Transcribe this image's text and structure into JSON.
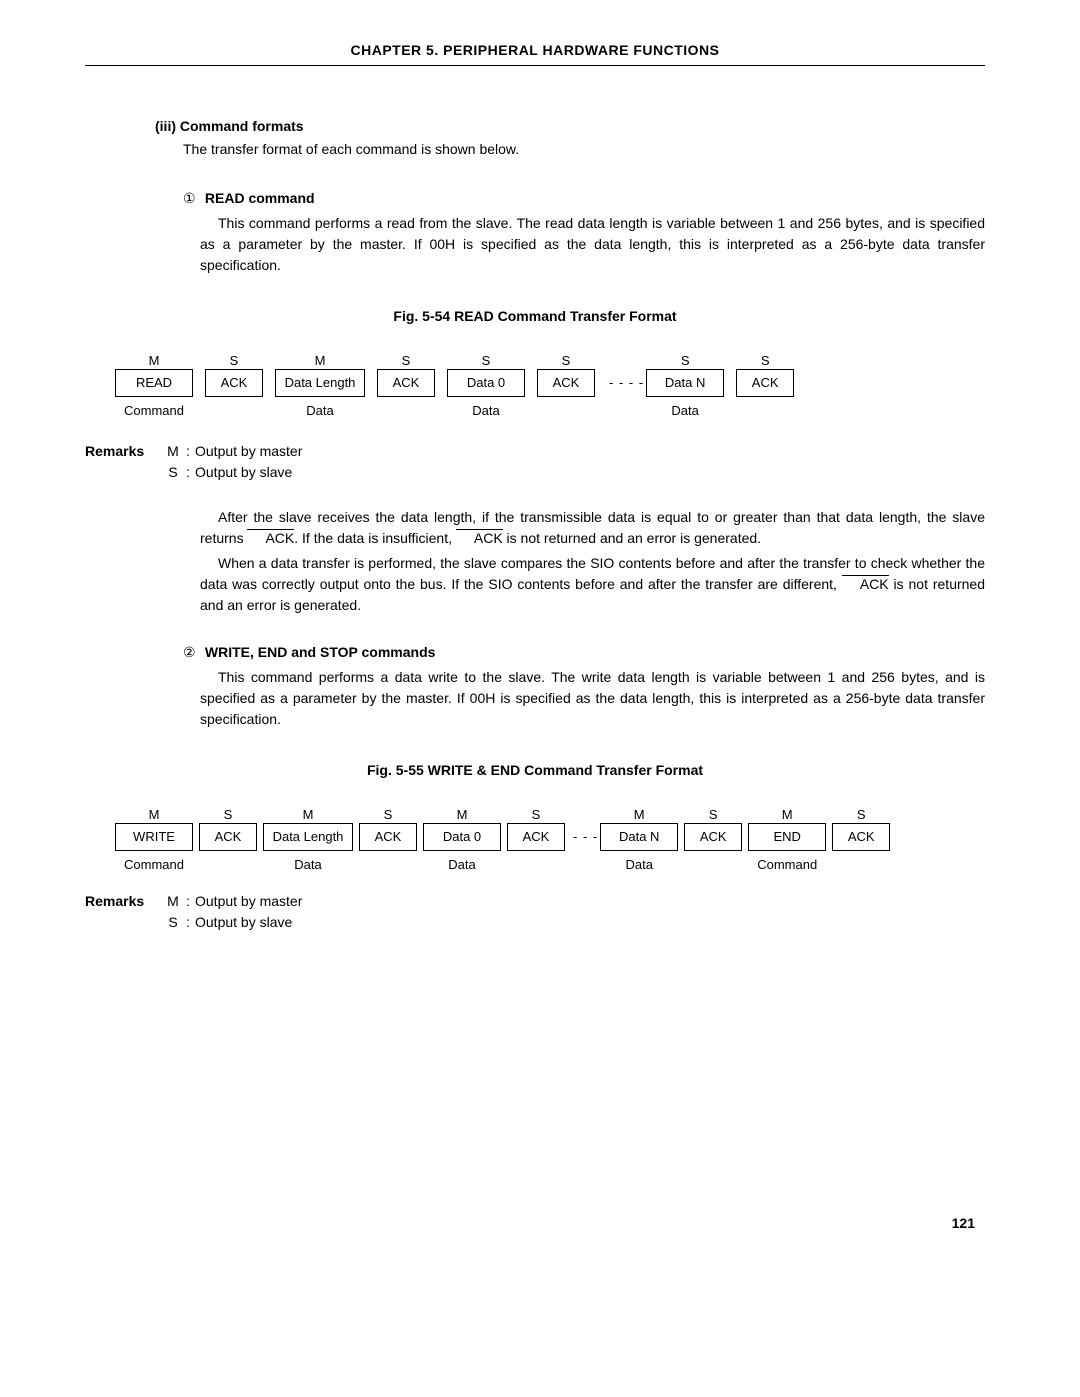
{
  "chapter_header": "CHAPTER  5.  PERIPHERAL  HARDWARE  FUNCTIONS",
  "section": {
    "label": "(iii)  Command formats",
    "intro": "The transfer format of each command is shown below."
  },
  "read": {
    "num": "①",
    "title": "READ command",
    "para": "This command performs a read from the slave. The read data length is variable between 1 and 256 bytes, and is specified as a parameter by the master. If 00H is specified as the data length, this is interpreted as a 256-byte data transfer specification.",
    "fig_caption": "Fig. 5-54  READ Command Transfer Format"
  },
  "fig54": {
    "blocks": [
      {
        "top": "M",
        "box": "READ",
        "bot": "Command",
        "w": "w70"
      },
      {
        "top": "S",
        "box": "ACK",
        "bot": "",
        "ack": true
      },
      {
        "top": "M",
        "box": "Data Length",
        "bot": "Data",
        "w": "w80"
      },
      {
        "top": "S",
        "box": "ACK",
        "bot": "",
        "ack": true
      },
      {
        "top": "S",
        "box": "Data 0",
        "bot": "Data",
        "w": "w70"
      },
      {
        "top": "S",
        "box": "ACK",
        "bot": "",
        "ack": true
      },
      {
        "dots": "- - - -"
      },
      {
        "top": "S",
        "box": "Data N",
        "bot": "Data",
        "w": "w70"
      },
      {
        "top": "S",
        "box": "ACK",
        "bot": "",
        "ack": true
      }
    ]
  },
  "remarks": {
    "label": "Remarks",
    "m": {
      "key": "M",
      "colon": ":",
      "text": "Output by master"
    },
    "s": {
      "key": "S",
      "colon": ":",
      "text": "Output by slave"
    }
  },
  "after_read": {
    "p1a": "After the slave receives the data length, if the transmissible data is equal to or greater than that data length, the slave returns ",
    "p1ack1": "ACK",
    "p1b": ". If the data is insufficient, ",
    "p1ack2": "ACK",
    "p1c": " is not returned and an error is generated.",
    "p2a": "When a data transfer is performed, the slave compares the SIO contents before and after the transfer to check whether the data was correctly output onto the bus. If the SIO contents before and after the transfer are different, ",
    "p2ack": "ACK",
    "p2b": " is not returned and an error is generated."
  },
  "write": {
    "num": "②",
    "title": "WRITE, END and STOP commands",
    "para": "This command performs a data write to the slave. The write data length is variable between 1 and 256 bytes, and is specified as a parameter by the master. If 00H is specified as the data length, this is interpreted as a 256-byte data transfer specification.",
    "fig_caption": "Fig. 5-55  WRITE & END Command Transfer Format"
  },
  "fig55": {
    "blocks": [
      {
        "top": "M",
        "box": "WRITE",
        "bot": "Command",
        "w": "w70"
      },
      {
        "top": "S",
        "box": "ACK",
        "bot": "",
        "ack": true
      },
      {
        "top": "M",
        "box": "Data Length",
        "bot": "Data",
        "w": "w80"
      },
      {
        "top": "S",
        "box": "ACK",
        "bot": "",
        "ack": true
      },
      {
        "top": "M",
        "box": "Data 0",
        "bot": "Data",
        "w": "w70"
      },
      {
        "top": "S",
        "box": "ACK",
        "bot": "",
        "ack": true
      },
      {
        "dots": "- - -"
      },
      {
        "top": "M",
        "box": "Data N",
        "bot": "Data",
        "w": "w70"
      },
      {
        "top": "S",
        "box": "ACK",
        "bot": "",
        "ack": true
      },
      {
        "top": "M",
        "box": "END",
        "bot": "Command",
        "w": "w70"
      },
      {
        "top": "S",
        "box": "ACK",
        "bot": "",
        "ack": true
      }
    ]
  },
  "page_number": "121"
}
